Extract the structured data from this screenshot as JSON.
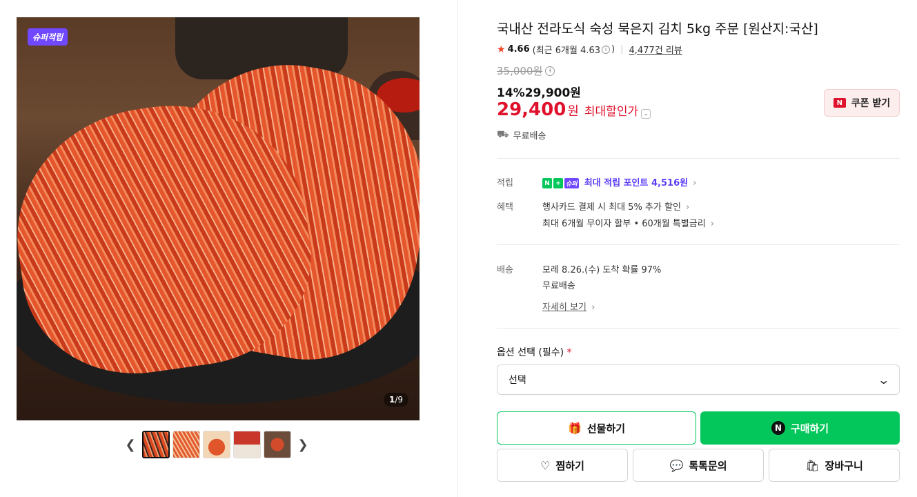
{
  "gallery": {
    "badge": "슈퍼적립",
    "counter_current": "1",
    "counter_total": "/9",
    "prev_icon": "chevron-left-icon",
    "next_icon": "chevron-right-icon",
    "thumbnail_count": 5
  },
  "product": {
    "title": "국내산 전라도식 숙성 묵은지 김치 5kg 주문 [원산지:국산]",
    "rating": "4.66",
    "rating_recent": "(최근 6개월 4.63",
    "rating_recent_close": ")",
    "review_count": "4,477건 리뷰",
    "original_price": "35,000원",
    "discount_rate": "14%",
    "sale_price": "29,900원",
    "max_price": "29,400",
    "max_unit": "원",
    "max_label": "최대할인가",
    "coupon_label": "쿠폰 받기",
    "coupon_icon": "N",
    "shipping_free": "무료배송"
  },
  "benefits": {
    "points_label": "적립",
    "points_badge_n": "N",
    "points_badge_plus": "+",
    "points_badge_super": "슈퍼",
    "points_text": "최대 적립 포인트 4,516원",
    "benefit_label": "혜택",
    "benefit_1": "행사카드 결제 시 최대 5% 추가 할인",
    "benefit_2": "최대 6개월 무이자 할부 • 60개월 특별금리"
  },
  "delivery": {
    "label": "배송",
    "arrival": "모레 8.26.(수) 도착 확률 97%",
    "fee": "무료배송",
    "detail_link": "자세히 보기"
  },
  "options": {
    "label": "옵션 선택 (필수)",
    "required_mark": "*",
    "selected": "선택"
  },
  "actions": {
    "gift": "선물하기",
    "buy": "구매하기",
    "buy_icon": "N",
    "wish": "찜하기",
    "talk": "톡톡문의",
    "cart": "장바구니"
  },
  "colors": {
    "naver_green": "#03c75a",
    "price_red": "#e0112c",
    "super_purple": "#7048ff"
  }
}
